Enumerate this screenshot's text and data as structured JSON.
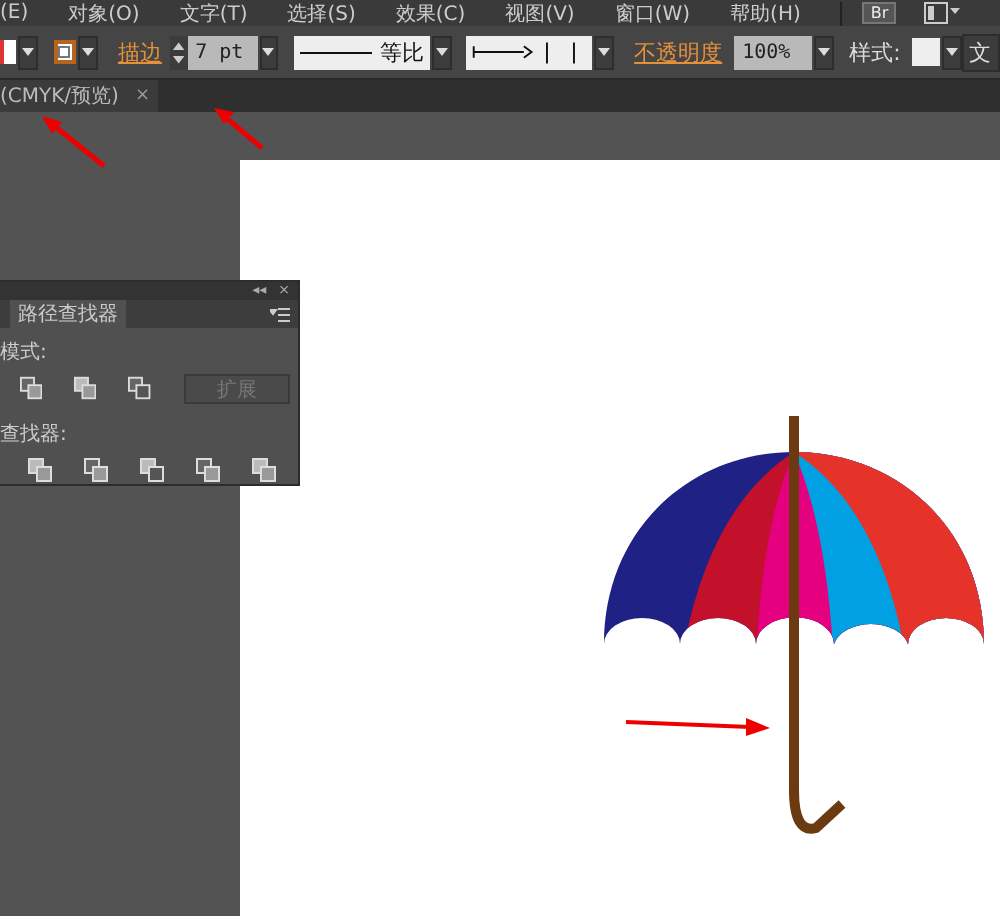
{
  "menu_bar": {
    "items": [
      "(E)",
      "对象(O)",
      "文字(T)",
      "选择(S)",
      "效果(C)",
      "视图(V)",
      "窗口(W)",
      "帮助(H)"
    ],
    "bridge_button": "Br"
  },
  "control_bar": {
    "stroke_label": "描边",
    "stroke_weight": "7 pt",
    "stroke_profile": "等比",
    "opacity_label": "不透明度",
    "opacity": "100%",
    "style_label": "样式:",
    "cut_button": "文"
  },
  "document_tab": {
    "title": "(CMYK/预览)",
    "close": "×"
  },
  "pathfinder_panel": {
    "collapse": "◂◂",
    "close": "×",
    "tab": "路径查找器",
    "shape_modes_label": "模式:",
    "expand_button": "扩展",
    "expand_disabled": true,
    "pathfinders_label": "查找器:"
  }
}
